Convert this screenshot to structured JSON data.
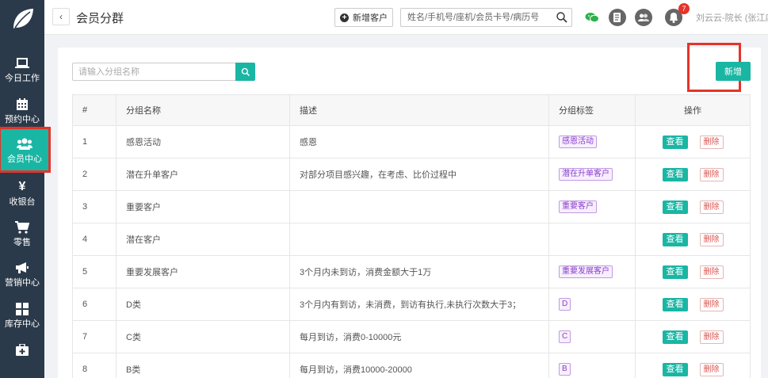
{
  "sidebar": {
    "items": [
      {
        "label": "今日工作",
        "icon": "laptop-icon"
      },
      {
        "label": "预约中心",
        "icon": "calendar-icon"
      },
      {
        "label": "会员中心",
        "icon": "users-icon"
      },
      {
        "label": "收银台",
        "icon": "yen-icon"
      },
      {
        "label": "零售",
        "icon": "cart-icon"
      },
      {
        "label": "营销中心",
        "icon": "megaphone-icon"
      },
      {
        "label": "库存中心",
        "icon": "grid-icon"
      },
      {
        "label": "",
        "icon": "medkit-icon"
      }
    ],
    "active_index": 2
  },
  "header": {
    "title": "会员分群",
    "add_customer_label": "新增客户",
    "search_placeholder": "姓名/手机号/座机/会员卡号/病历号",
    "notification_count": "7",
    "user": "刘云云-院长 (张江店)"
  },
  "toolbar": {
    "group_search_placeholder": "请输入分组名称",
    "new_label": "新增"
  },
  "table": {
    "columns": [
      "#",
      "分组名称",
      "描述",
      "分组标签",
      "操作"
    ],
    "view_label": "查看",
    "delete_label": "删除",
    "rows": [
      {
        "index": "1",
        "name": "感恩活动",
        "desc": "感恩",
        "tag": "感恩活动"
      },
      {
        "index": "2",
        "name": "潜在升单客户",
        "desc": "对部分项目感兴趣，在考虑、比价过程中",
        "tag": "潜在升单客户"
      },
      {
        "index": "3",
        "name": "重要客户",
        "desc": "",
        "tag": "重要客户"
      },
      {
        "index": "4",
        "name": "潜在客户",
        "desc": "",
        "tag": ""
      },
      {
        "index": "5",
        "name": "重要发展客户",
        "desc": "3个月内未到访，消费金额大于1万",
        "tag": "重要发展客户"
      },
      {
        "index": "6",
        "name": "D类",
        "desc": "3个月内有到访，未消费，到访有执行,未执行次数大于3；",
        "tag": "D"
      },
      {
        "index": "7",
        "name": "C类",
        "desc": "每月到访，消费0-10000元",
        "tag": "C"
      },
      {
        "index": "8",
        "name": "B类",
        "desc": "每月到访，消费10000-20000",
        "tag": "B"
      }
    ]
  },
  "colors": {
    "accent": "#1ab6a4",
    "sidebar_bg": "#2b3a4a",
    "highlight": "#e63329",
    "tag": "#8a3fc8"
  }
}
